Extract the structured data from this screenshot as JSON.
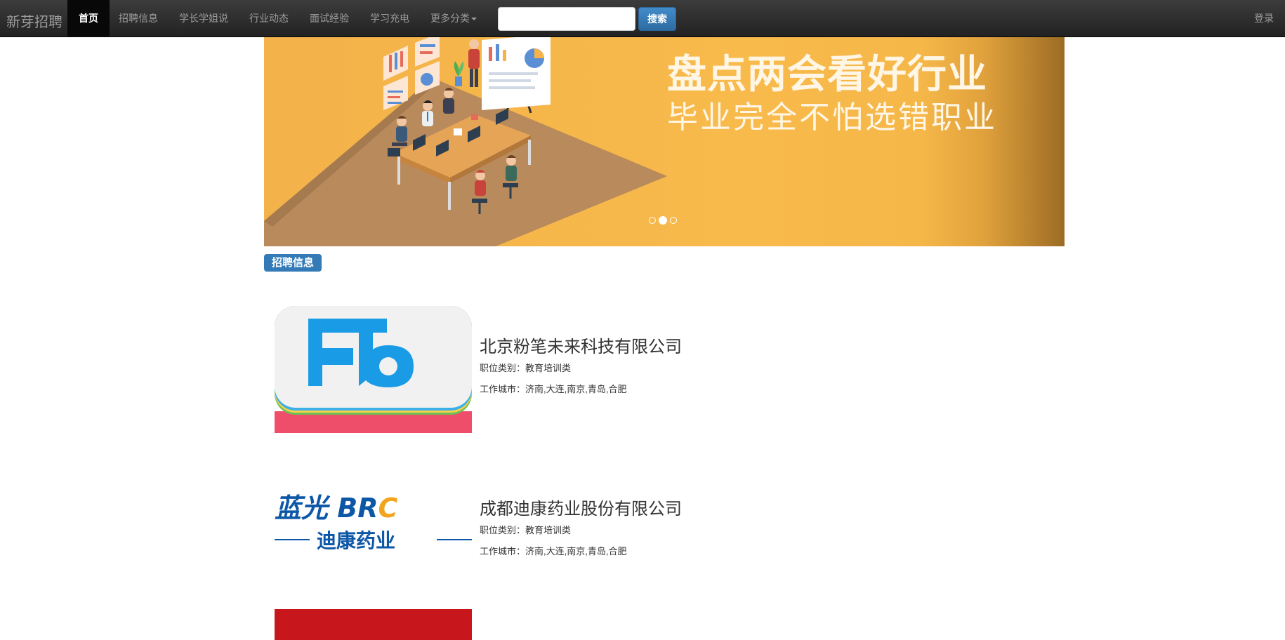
{
  "navbar": {
    "brand": "新芽招聘",
    "items": [
      {
        "label": "首页",
        "active": true
      },
      {
        "label": "招聘信息"
      },
      {
        "label": "学长学姐说"
      },
      {
        "label": "行业动态"
      },
      {
        "label": "面试经验"
      },
      {
        "label": "学习充电"
      },
      {
        "label": "更多分类"
      }
    ],
    "search": {
      "value": "",
      "button": "搜索"
    },
    "login": "登录"
  },
  "banner": {
    "headline": "盘点两会看好行业",
    "subline": "毕业完全不怕选错职业",
    "slides": 3,
    "active_slide": 2
  },
  "section": {
    "label": "招聘信息"
  },
  "listings": [
    {
      "company": "北京粉笔未来科技有限公司",
      "category_label": "职位类别：",
      "category": "教育培训类",
      "city_label": "工作城市：",
      "cities": "济南,大连,南京,青岛,合肥",
      "logo": {
        "type": "fb",
        "text": "Fb"
      }
    },
    {
      "company": "成都迪康药业股份有限公司",
      "category_label": "职位类别：",
      "category": "教育培训类",
      "city_label": "工作城市：",
      "cities": "济南,大连,南京,青岛,合肥",
      "logo": {
        "type": "text",
        "line1": "蓝光 BRC",
        "line2": "迪康药业"
      }
    },
    {
      "logo": {
        "type": "red-block",
        "color": "#c8161d"
      }
    }
  ],
  "colors": {
    "navbar": "#222222",
    "accent": "#337ab7",
    "banner": "#f8ba4b",
    "fb_blue": "#1a9be6",
    "brc_blue": "#0d57a7"
  }
}
